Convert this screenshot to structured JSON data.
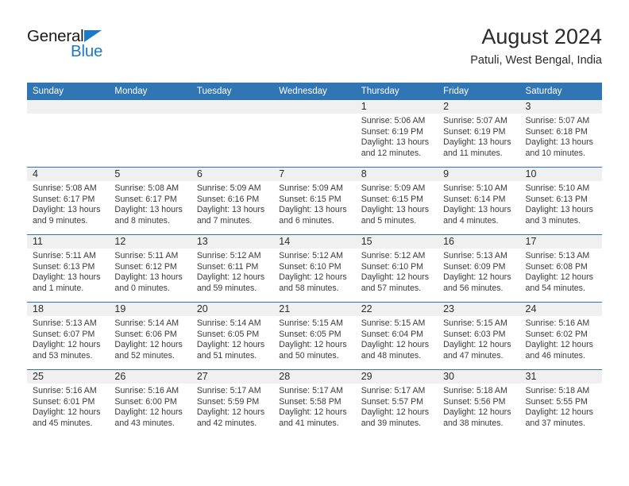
{
  "logo": {
    "word_top": "General",
    "word_bottom": "Blue",
    "triangle_color": "#1f7ac4"
  },
  "header": {
    "title": "August 2024",
    "subtitle": "Patuli, West Bengal, India"
  },
  "theme": {
    "header_blue": "#3076b5",
    "date_band_gray": "#f0f0f0",
    "text_color": "#3a3a3a"
  },
  "weekday_headers": [
    "Sunday",
    "Monday",
    "Tuesday",
    "Wednesday",
    "Thursday",
    "Friday",
    "Saturday"
  ],
  "weeks": [
    [
      {
        "day": "",
        "lines": []
      },
      {
        "day": "",
        "lines": []
      },
      {
        "day": "",
        "lines": []
      },
      {
        "day": "",
        "lines": []
      },
      {
        "day": "1",
        "lines": [
          "Sunrise: 5:06 AM",
          "Sunset: 6:19 PM",
          "Daylight: 13 hours",
          "and 12 minutes."
        ]
      },
      {
        "day": "2",
        "lines": [
          "Sunrise: 5:07 AM",
          "Sunset: 6:19 PM",
          "Daylight: 13 hours",
          "and 11 minutes."
        ]
      },
      {
        "day": "3",
        "lines": [
          "Sunrise: 5:07 AM",
          "Sunset: 6:18 PM",
          "Daylight: 13 hours",
          "and 10 minutes."
        ]
      }
    ],
    [
      {
        "day": "4",
        "lines": [
          "Sunrise: 5:08 AM",
          "Sunset: 6:17 PM",
          "Daylight: 13 hours",
          "and 9 minutes."
        ]
      },
      {
        "day": "5",
        "lines": [
          "Sunrise: 5:08 AM",
          "Sunset: 6:17 PM",
          "Daylight: 13 hours",
          "and 8 minutes."
        ]
      },
      {
        "day": "6",
        "lines": [
          "Sunrise: 5:09 AM",
          "Sunset: 6:16 PM",
          "Daylight: 13 hours",
          "and 7 minutes."
        ]
      },
      {
        "day": "7",
        "lines": [
          "Sunrise: 5:09 AM",
          "Sunset: 6:15 PM",
          "Daylight: 13 hours",
          "and 6 minutes."
        ]
      },
      {
        "day": "8",
        "lines": [
          "Sunrise: 5:09 AM",
          "Sunset: 6:15 PM",
          "Daylight: 13 hours",
          "and 5 minutes."
        ]
      },
      {
        "day": "9",
        "lines": [
          "Sunrise: 5:10 AM",
          "Sunset: 6:14 PM",
          "Daylight: 13 hours",
          "and 4 minutes."
        ]
      },
      {
        "day": "10",
        "lines": [
          "Sunrise: 5:10 AM",
          "Sunset: 6:13 PM",
          "Daylight: 13 hours",
          "and 3 minutes."
        ]
      }
    ],
    [
      {
        "day": "11",
        "lines": [
          "Sunrise: 5:11 AM",
          "Sunset: 6:13 PM",
          "Daylight: 13 hours",
          "and 1 minute."
        ]
      },
      {
        "day": "12",
        "lines": [
          "Sunrise: 5:11 AM",
          "Sunset: 6:12 PM",
          "Daylight: 13 hours",
          "and 0 minutes."
        ]
      },
      {
        "day": "13",
        "lines": [
          "Sunrise: 5:12 AM",
          "Sunset: 6:11 PM",
          "Daylight: 12 hours",
          "and 59 minutes."
        ]
      },
      {
        "day": "14",
        "lines": [
          "Sunrise: 5:12 AM",
          "Sunset: 6:10 PM",
          "Daylight: 12 hours",
          "and 58 minutes."
        ]
      },
      {
        "day": "15",
        "lines": [
          "Sunrise: 5:12 AM",
          "Sunset: 6:10 PM",
          "Daylight: 12 hours",
          "and 57 minutes."
        ]
      },
      {
        "day": "16",
        "lines": [
          "Sunrise: 5:13 AM",
          "Sunset: 6:09 PM",
          "Daylight: 12 hours",
          "and 56 minutes."
        ]
      },
      {
        "day": "17",
        "lines": [
          "Sunrise: 5:13 AM",
          "Sunset: 6:08 PM",
          "Daylight: 12 hours",
          "and 54 minutes."
        ]
      }
    ],
    [
      {
        "day": "18",
        "lines": [
          "Sunrise: 5:13 AM",
          "Sunset: 6:07 PM",
          "Daylight: 12 hours",
          "and 53 minutes."
        ]
      },
      {
        "day": "19",
        "lines": [
          "Sunrise: 5:14 AM",
          "Sunset: 6:06 PM",
          "Daylight: 12 hours",
          "and 52 minutes."
        ]
      },
      {
        "day": "20",
        "lines": [
          "Sunrise: 5:14 AM",
          "Sunset: 6:05 PM",
          "Daylight: 12 hours",
          "and 51 minutes."
        ]
      },
      {
        "day": "21",
        "lines": [
          "Sunrise: 5:15 AM",
          "Sunset: 6:05 PM",
          "Daylight: 12 hours",
          "and 50 minutes."
        ]
      },
      {
        "day": "22",
        "lines": [
          "Sunrise: 5:15 AM",
          "Sunset: 6:04 PM",
          "Daylight: 12 hours",
          "and 48 minutes."
        ]
      },
      {
        "day": "23",
        "lines": [
          "Sunrise: 5:15 AM",
          "Sunset: 6:03 PM",
          "Daylight: 12 hours",
          "and 47 minutes."
        ]
      },
      {
        "day": "24",
        "lines": [
          "Sunrise: 5:16 AM",
          "Sunset: 6:02 PM",
          "Daylight: 12 hours",
          "and 46 minutes."
        ]
      }
    ],
    [
      {
        "day": "25",
        "lines": [
          "Sunrise: 5:16 AM",
          "Sunset: 6:01 PM",
          "Daylight: 12 hours",
          "and 45 minutes."
        ]
      },
      {
        "day": "26",
        "lines": [
          "Sunrise: 5:16 AM",
          "Sunset: 6:00 PM",
          "Daylight: 12 hours",
          "and 43 minutes."
        ]
      },
      {
        "day": "27",
        "lines": [
          "Sunrise: 5:17 AM",
          "Sunset: 5:59 PM",
          "Daylight: 12 hours",
          "and 42 minutes."
        ]
      },
      {
        "day": "28",
        "lines": [
          "Sunrise: 5:17 AM",
          "Sunset: 5:58 PM",
          "Daylight: 12 hours",
          "and 41 minutes."
        ]
      },
      {
        "day": "29",
        "lines": [
          "Sunrise: 5:17 AM",
          "Sunset: 5:57 PM",
          "Daylight: 12 hours",
          "and 39 minutes."
        ]
      },
      {
        "day": "30",
        "lines": [
          "Sunrise: 5:18 AM",
          "Sunset: 5:56 PM",
          "Daylight: 12 hours",
          "and 38 minutes."
        ]
      },
      {
        "day": "31",
        "lines": [
          "Sunrise: 5:18 AM",
          "Sunset: 5:55 PM",
          "Daylight: 12 hours",
          "and 37 minutes."
        ]
      }
    ]
  ]
}
